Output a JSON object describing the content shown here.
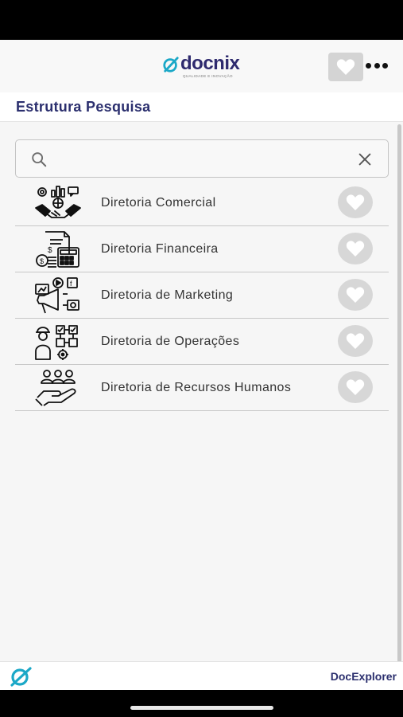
{
  "header": {
    "logo_text": "docnix",
    "logo_tagline": "QUALIDADE E INOVAÇÃO",
    "favorite_icon": "heart-icon",
    "more_icon": "more-horizontal-icon"
  },
  "page": {
    "title": "Estrutura Pesquisa"
  },
  "search": {
    "placeholder": "",
    "value": "",
    "search_icon": "search-icon",
    "clear_icon": "close-icon"
  },
  "items": [
    {
      "label": "Diretoria Comercial",
      "icon": "handshake-icon"
    },
    {
      "label": "Diretoria Financeira",
      "icon": "finance-calculator-icon"
    },
    {
      "label": "Diretoria de Marketing",
      "icon": "marketing-megaphone-icon"
    },
    {
      "label": "Diretoria de Operações",
      "icon": "operations-worker-icon"
    },
    {
      "label": "Diretoria de Recursos Humanos",
      "icon": "people-hand-icon"
    }
  ],
  "footer": {
    "label": "DocExplorer",
    "logo_icon": "docnix-mark-icon"
  },
  "colors": {
    "brand_navy": "#2b2f6e",
    "brand_teal": "#1ba8c7",
    "heart_bg": "#d7d7d7"
  }
}
